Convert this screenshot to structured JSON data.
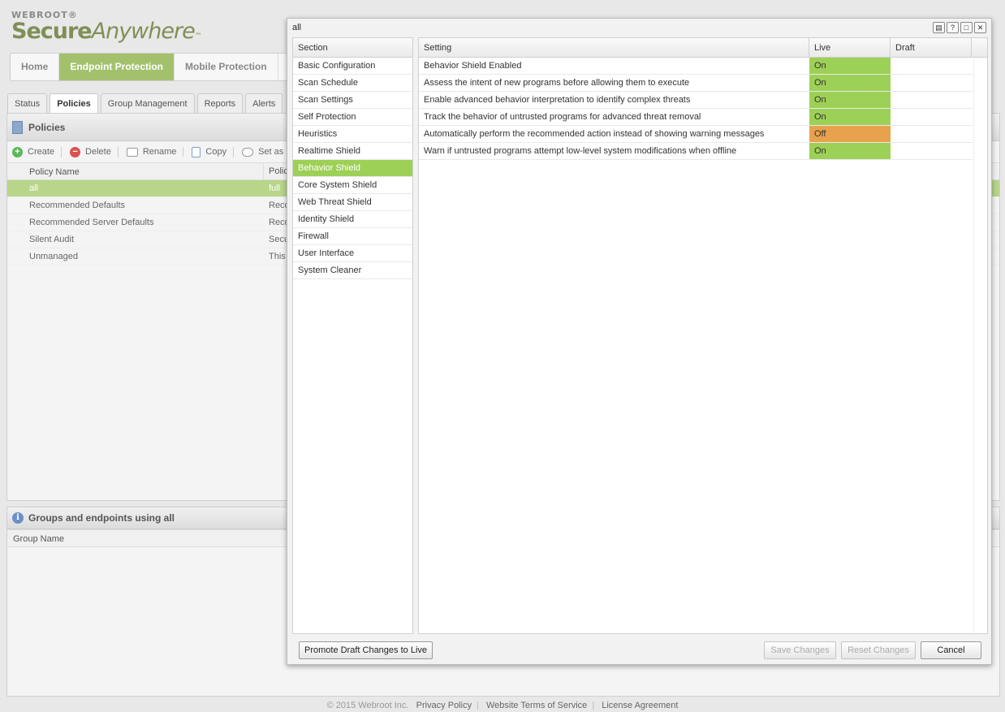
{
  "app": {
    "brand_top": "WEBROOT®",
    "brand_secure": "Secure",
    "brand_anywhere": "Anywhere",
    "brand_tm": "™"
  },
  "main_nav": [
    {
      "label": "Home",
      "active": false
    },
    {
      "label": "Endpoint Protection",
      "active": true
    },
    {
      "label": "Mobile Protection",
      "active": false
    }
  ],
  "sub_tabs": [
    {
      "label": "Status",
      "active": false
    },
    {
      "label": "Policies",
      "active": true
    },
    {
      "label": "Group Management",
      "active": false
    },
    {
      "label": "Reports",
      "active": false
    },
    {
      "label": "Alerts",
      "active": false
    }
  ],
  "policies": {
    "title": "Policies",
    "toolbar": {
      "create": "Create",
      "delete": "Delete",
      "rename": "Rename",
      "copy": "Copy",
      "set_as": "Set as"
    },
    "columns": [
      "Policy Name",
      "Polic"
    ],
    "rows": [
      {
        "name": "all",
        "desc": "full",
        "selected": true
      },
      {
        "name": "Recommended Defaults",
        "desc": "Reco",
        "selected": false
      },
      {
        "name": "Recommended Server Defaults",
        "desc": "Reco",
        "selected": false
      },
      {
        "name": "Silent Audit",
        "desc": "Secu",
        "selected": false
      },
      {
        "name": "Unmanaged",
        "desc": "This",
        "selected": false
      }
    ]
  },
  "groups": {
    "title": "Groups and endpoints using all",
    "column": "Group Name"
  },
  "footer": {
    "copyright": "© 2015 Webroot Inc.",
    "privacy": "Privacy Policy",
    "terms": "Website Terms of Service",
    "license": "License Agreement"
  },
  "modal": {
    "title": "all",
    "section_header": "Section",
    "sections": [
      {
        "label": "Basic Configuration",
        "selected": false
      },
      {
        "label": "Scan Schedule",
        "selected": false
      },
      {
        "label": "Scan Settings",
        "selected": false
      },
      {
        "label": "Self Protection",
        "selected": false
      },
      {
        "label": "Heuristics",
        "selected": false
      },
      {
        "label": "Realtime Shield",
        "selected": false
      },
      {
        "label": "Behavior Shield",
        "selected": true
      },
      {
        "label": "Core System Shield",
        "selected": false
      },
      {
        "label": "Web Threat Shield",
        "selected": false
      },
      {
        "label": "Identity Shield",
        "selected": false
      },
      {
        "label": "Firewall",
        "selected": false
      },
      {
        "label": "User Interface",
        "selected": false
      },
      {
        "label": "System Cleaner",
        "selected": false
      }
    ],
    "settings_columns": {
      "setting": "Setting",
      "live": "Live",
      "draft": "Draft"
    },
    "settings": [
      {
        "setting": "Behavior Shield Enabled",
        "live": "On",
        "draft": ""
      },
      {
        "setting": "Assess the intent of new programs before allowing them to execute",
        "live": "On",
        "draft": ""
      },
      {
        "setting": "Enable advanced behavior interpretation to identify complex threats",
        "live": "On",
        "draft": ""
      },
      {
        "setting": "Track the behavior of untrusted programs for advanced threat removal",
        "live": "On",
        "draft": ""
      },
      {
        "setting": "Automatically perform the recommended action instead of showing warning messages",
        "live": "Off",
        "draft": ""
      },
      {
        "setting": "Warn if untrusted programs attempt low-level system modifications when offline",
        "live": "On",
        "draft": ""
      }
    ],
    "buttons": {
      "promote": "Promote Draft Changes to Live",
      "save": "Save Changes",
      "reset": "Reset Changes",
      "cancel": "Cancel"
    },
    "colors": {
      "on": "#9dd056",
      "off": "#e8a24e",
      "selected": "#9dd056"
    }
  }
}
